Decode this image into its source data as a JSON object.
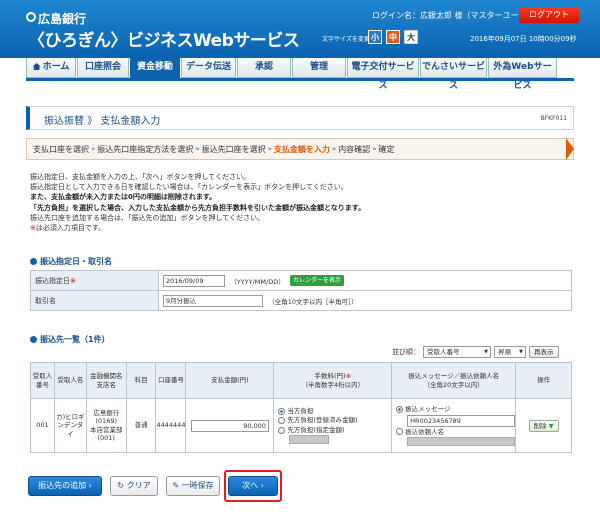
{
  "header": {
    "bank_name": "広島銀行",
    "service_name": "〈ひろぎん〉ビジネスWebサービス",
    "login_text": "ログイン名：広銀太郎 様（マスターユーザ）",
    "logout_label": "ログアウト",
    "font_size_label": "文字サイズを変更",
    "font_small": "小",
    "font_medium": "中",
    "font_large": "大",
    "datetime": "2016年09月07日 10時00分09秒"
  },
  "nav": {
    "tabs": [
      "ホーム",
      "口座照会",
      "資金移動",
      "データ伝送",
      "承認",
      "管理",
      "電子交付サービス",
      "でんさいサービス",
      "外為Webサービス"
    ],
    "active": "資金移動"
  },
  "page": {
    "title": "振込振替 》 支払金額入力",
    "id": "BFKF011"
  },
  "steps": {
    "items": [
      "支払口座を選択",
      "振込先口座指定方法を選択",
      "振込先口座を選択",
      "支払金額を入力",
      "内容確認",
      "確定"
    ],
    "current": "支払金額を入力",
    "separator": "»"
  },
  "instructions": {
    "l1": "振込指定日、支払金額を入力の上、「次へ」ボタンを押してください。",
    "l2": "振込指定日として入力できる日を確認したい場合は、「カレンダーを表示」ボタンを押してください。",
    "l3": "また、支払金額が未入力または0円の明細は削除されます。",
    "l4": "「先方負担」を選択した場合、入力した支払金額から先方負担手数料を引いた金額が振込金額となります。",
    "l5": "振込先口座を追加する場合は、「振込先の追加」ボタンを押してください。",
    "l6_mark": "※",
    "l6": "は必須入力項目です。"
  },
  "section1": {
    "title": "振込指定日・取引名",
    "date_label": "振込指定日",
    "date_req": "※",
    "date_value": "2016/09/09",
    "date_hint": "（YYYY/MM/DD）",
    "calendar_button": "カレンダーを表示",
    "name_label": "取引名",
    "name_value": "9月分振込",
    "name_hint": "（全角10文字以内［半角可］）"
  },
  "section2": {
    "title": "振込先一覧（1件）",
    "sort_label": "並び順：",
    "sort_value": "受取人番号",
    "order_value": "昇順",
    "rearrange_button": "再表示"
  },
  "table": {
    "headers": {
      "recipient_no": "受取人番号",
      "recipient_name": "受取人名",
      "bank_branch": "金融機関名支店名",
      "subject": "科目",
      "account_no": "口座番号",
      "amount": "支払金額(円)",
      "fee": "手数料(円)",
      "fee_req": "※",
      "fee_sub": "（半角数字4桁以内）",
      "message": "振込メッセージ／振込依頼人名",
      "message_sub": "（全角20文字以内）",
      "action": "操作"
    },
    "row": {
      "recipient_no": "001",
      "recipient_name": "カ)ヒロギンデンタイ",
      "bank_line1": "広島銀行",
      "bank_line2": "(0169)",
      "bank_line3": "本店営業部(001)",
      "subject": "普通",
      "account_no": "4444444",
      "amount": "90,000",
      "fee_opt1": "当方負担",
      "fee_opt2": "先方負担(登録済み金額)",
      "fee_opt3": "先方負担(指定金額)",
      "msg_opt1": "振込メッセージ",
      "msg_value": "HR0023456789",
      "msg_opt2": "振込依頼人名",
      "delete_button": "削除"
    }
  },
  "buttons": {
    "add_recipient": "振込先の追加",
    "clear": "クリア",
    "save": "一時保存",
    "next": "次へ"
  }
}
